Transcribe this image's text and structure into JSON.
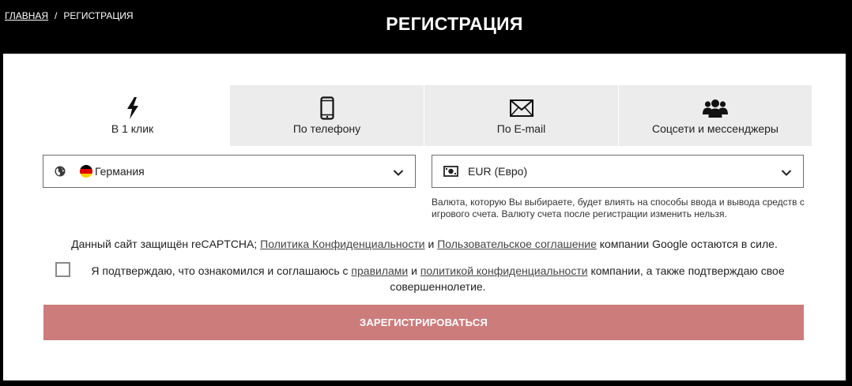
{
  "breadcrumb": {
    "home": "ГЛАВНАЯ",
    "separator": "/",
    "current": "РЕГИСТРАЦИЯ"
  },
  "page_title": "РЕГИСТРАЦИЯ",
  "tabs": [
    {
      "label": "В 1 клик",
      "icon": "lightning-icon",
      "active": true
    },
    {
      "label": "По телефону",
      "icon": "phone-icon",
      "active": false
    },
    {
      "label": "По E-mail",
      "icon": "envelope-icon",
      "active": false
    },
    {
      "label": "Соцсети и мессенджеры",
      "icon": "users-icon",
      "active": false
    }
  ],
  "country": {
    "value": "Германия",
    "icon": "globe-icon",
    "flag": "germany-flag-icon",
    "flag_colors": [
      "#000000",
      "#dd0000",
      "#ffce00"
    ]
  },
  "currency": {
    "value": "EUR (Евро)",
    "icon": "banknote-icon",
    "hint": "Валюта, которую Вы выбираете, будет влиять на способы ввода и вывода средств с игрового счета. Валюту счета после регистрации изменить нельзя."
  },
  "recaptcha": {
    "prefix": "Данный сайт защищён reCAPTCHA; ",
    "privacy_link": "Политика Конфиденциальности",
    "and": " и ",
    "terms_link": "Пользовательское соглашение",
    "suffix": " компании Google остаются в силе."
  },
  "confirm": {
    "prefix": "Я подтверждаю, что ознакомился и соглашаюсь с ",
    "rules_link": "правилами",
    "and": " и ",
    "policy_link": "политикой конфиденциальности",
    "suffix": " компании, а также подтверждаю свое совершеннолетие.",
    "checked": false
  },
  "submit_label": "ЗАРЕГИСТРИРОВАТЬСЯ",
  "colors": {
    "header_bg": "#000000",
    "tab_inactive": "#ececec",
    "submit_bg": "#cd7c7c"
  }
}
